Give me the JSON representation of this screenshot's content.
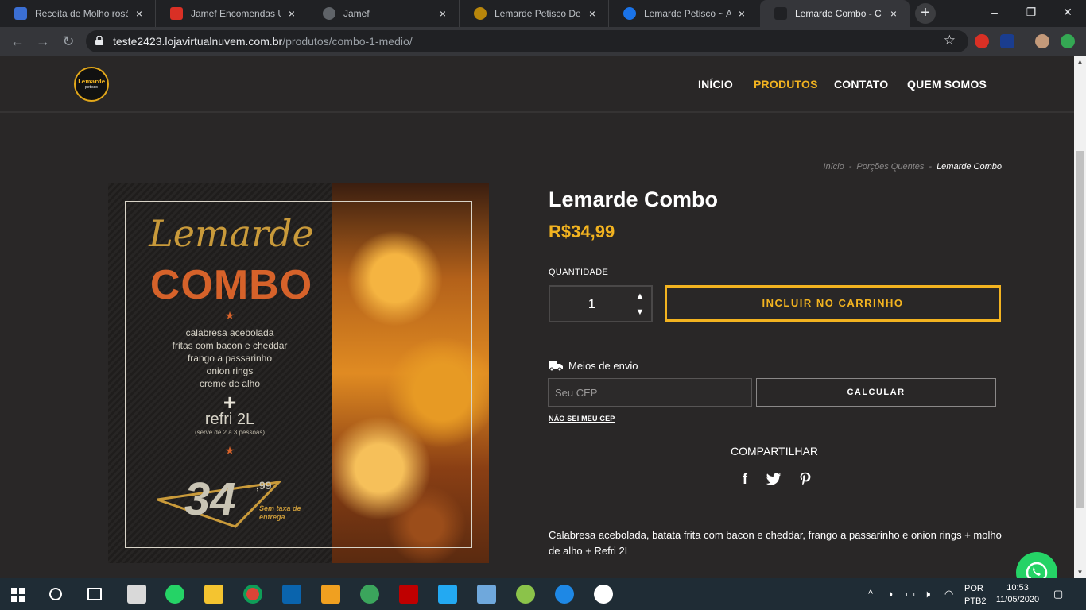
{
  "browser": {
    "tabs": [
      {
        "title": "Receita de Molho rosé",
        "favicon_color": "#3b6fd4"
      },
      {
        "title": "Jamef Encomendas Urg",
        "favicon_color": "#d93025"
      },
      {
        "title": "Jamef",
        "favicon_color": "#5f6368"
      },
      {
        "title": "Lemarde Petisco Delive",
        "favicon_color": "#b8860b"
      },
      {
        "title": "Lemarde Petisco ~ Adm",
        "favicon_color": "#1a73e8"
      },
      {
        "title": "Lemarde Combo - Com",
        "favicon_color": "#202124"
      }
    ],
    "url_host": "teste2423.lojavirtualnuvem.com.br",
    "url_path": "/produtos/combo-1-medio/"
  },
  "site": {
    "logo_text": "Lemarde",
    "logo_sub": "petisco",
    "nav": [
      "INÍCIO",
      "PRODUTOS",
      "CONTATO",
      "QUEM SOMOS"
    ]
  },
  "breadcrumb": [
    "Início",
    "Porções Quentes",
    "Lemarde Combo"
  ],
  "product": {
    "name": "Lemarde Combo",
    "price": "R$34,99",
    "quantity_label": "QUANTIDADE",
    "quantity": "1",
    "add_to_cart": "INCLUIR NO CARRINHO",
    "shipping_label": "Meios de envio",
    "cep_placeholder": "Seu CEP",
    "calc_button": "CALCULAR",
    "no_cep_link": "NÃO SEI MEU CEP",
    "share_label": "COMPARTILHAR",
    "description": "Calabresa acebolada, batata frita com bacon e cheddar, frango a passarinho e onion rings + molho de alho + Refri 2L",
    "image": {
      "title1": "Lemarde",
      "title2": "COMBO",
      "items": [
        "calabresa acebolada",
        "fritas com bacon e cheddar",
        "frango a passarinho",
        "onion rings",
        "creme de alho"
      ],
      "plus": "+",
      "refri": "refri 2L",
      "serve": "(serve de 2 a 3 pessoas)",
      "price_int": "34",
      "price_cents": ",99",
      "no_fee": "Sem taxa de entrega"
    }
  },
  "taskbar": {
    "lang1": "POR",
    "lang2": "PTB2",
    "time": "10:53",
    "date": "11/05/2020"
  },
  "colors": {
    "accent": "#f2b320",
    "background": "#292727",
    "whatsapp": "#25d366"
  }
}
